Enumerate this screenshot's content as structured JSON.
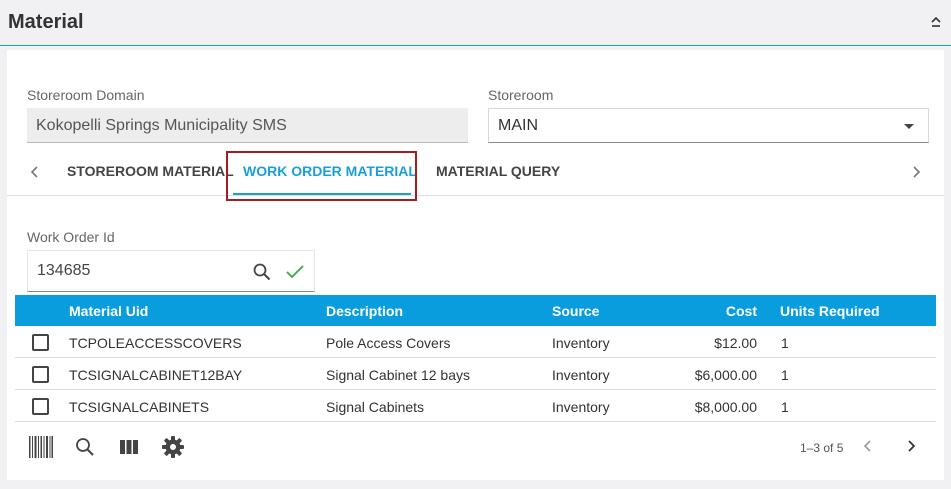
{
  "header": {
    "title": "Material"
  },
  "fields": {
    "storeroom_domain": {
      "label": "Storeroom Domain",
      "value": "Kokopelli Springs Municipality SMS"
    },
    "storeroom": {
      "label": "Storeroom",
      "value": "MAIN"
    }
  },
  "tabs": [
    {
      "label": "STOREROOM MATERIAL"
    },
    {
      "label": "WORK ORDER MATERIAL",
      "active": true
    },
    {
      "label": "MATERIAL QUERY"
    }
  ],
  "work_order": {
    "label": "Work Order Id",
    "value": "134685"
  },
  "table": {
    "columns": [
      "Material Uid",
      "Description",
      "Source",
      "Cost",
      "Units Required"
    ],
    "rows": [
      [
        "TCPOLEACCESSCOVERS",
        "Pole Access Covers",
        "Inventory",
        "$12.00",
        "1"
      ],
      [
        "TCSIGNALCABINET12BAY",
        "Signal Cabinet 12 bays",
        "Inventory",
        "$6,000.00",
        "1"
      ],
      [
        "TCSIGNALCABINETS",
        "Signal Cabinets",
        "Inventory",
        "$8,000.00",
        "1"
      ]
    ]
  },
  "pager": {
    "text": "1–3 of 5"
  },
  "colors": {
    "accent": "#0a9ddd",
    "highlight": "#a01e1e",
    "check": "#4caf50"
  }
}
